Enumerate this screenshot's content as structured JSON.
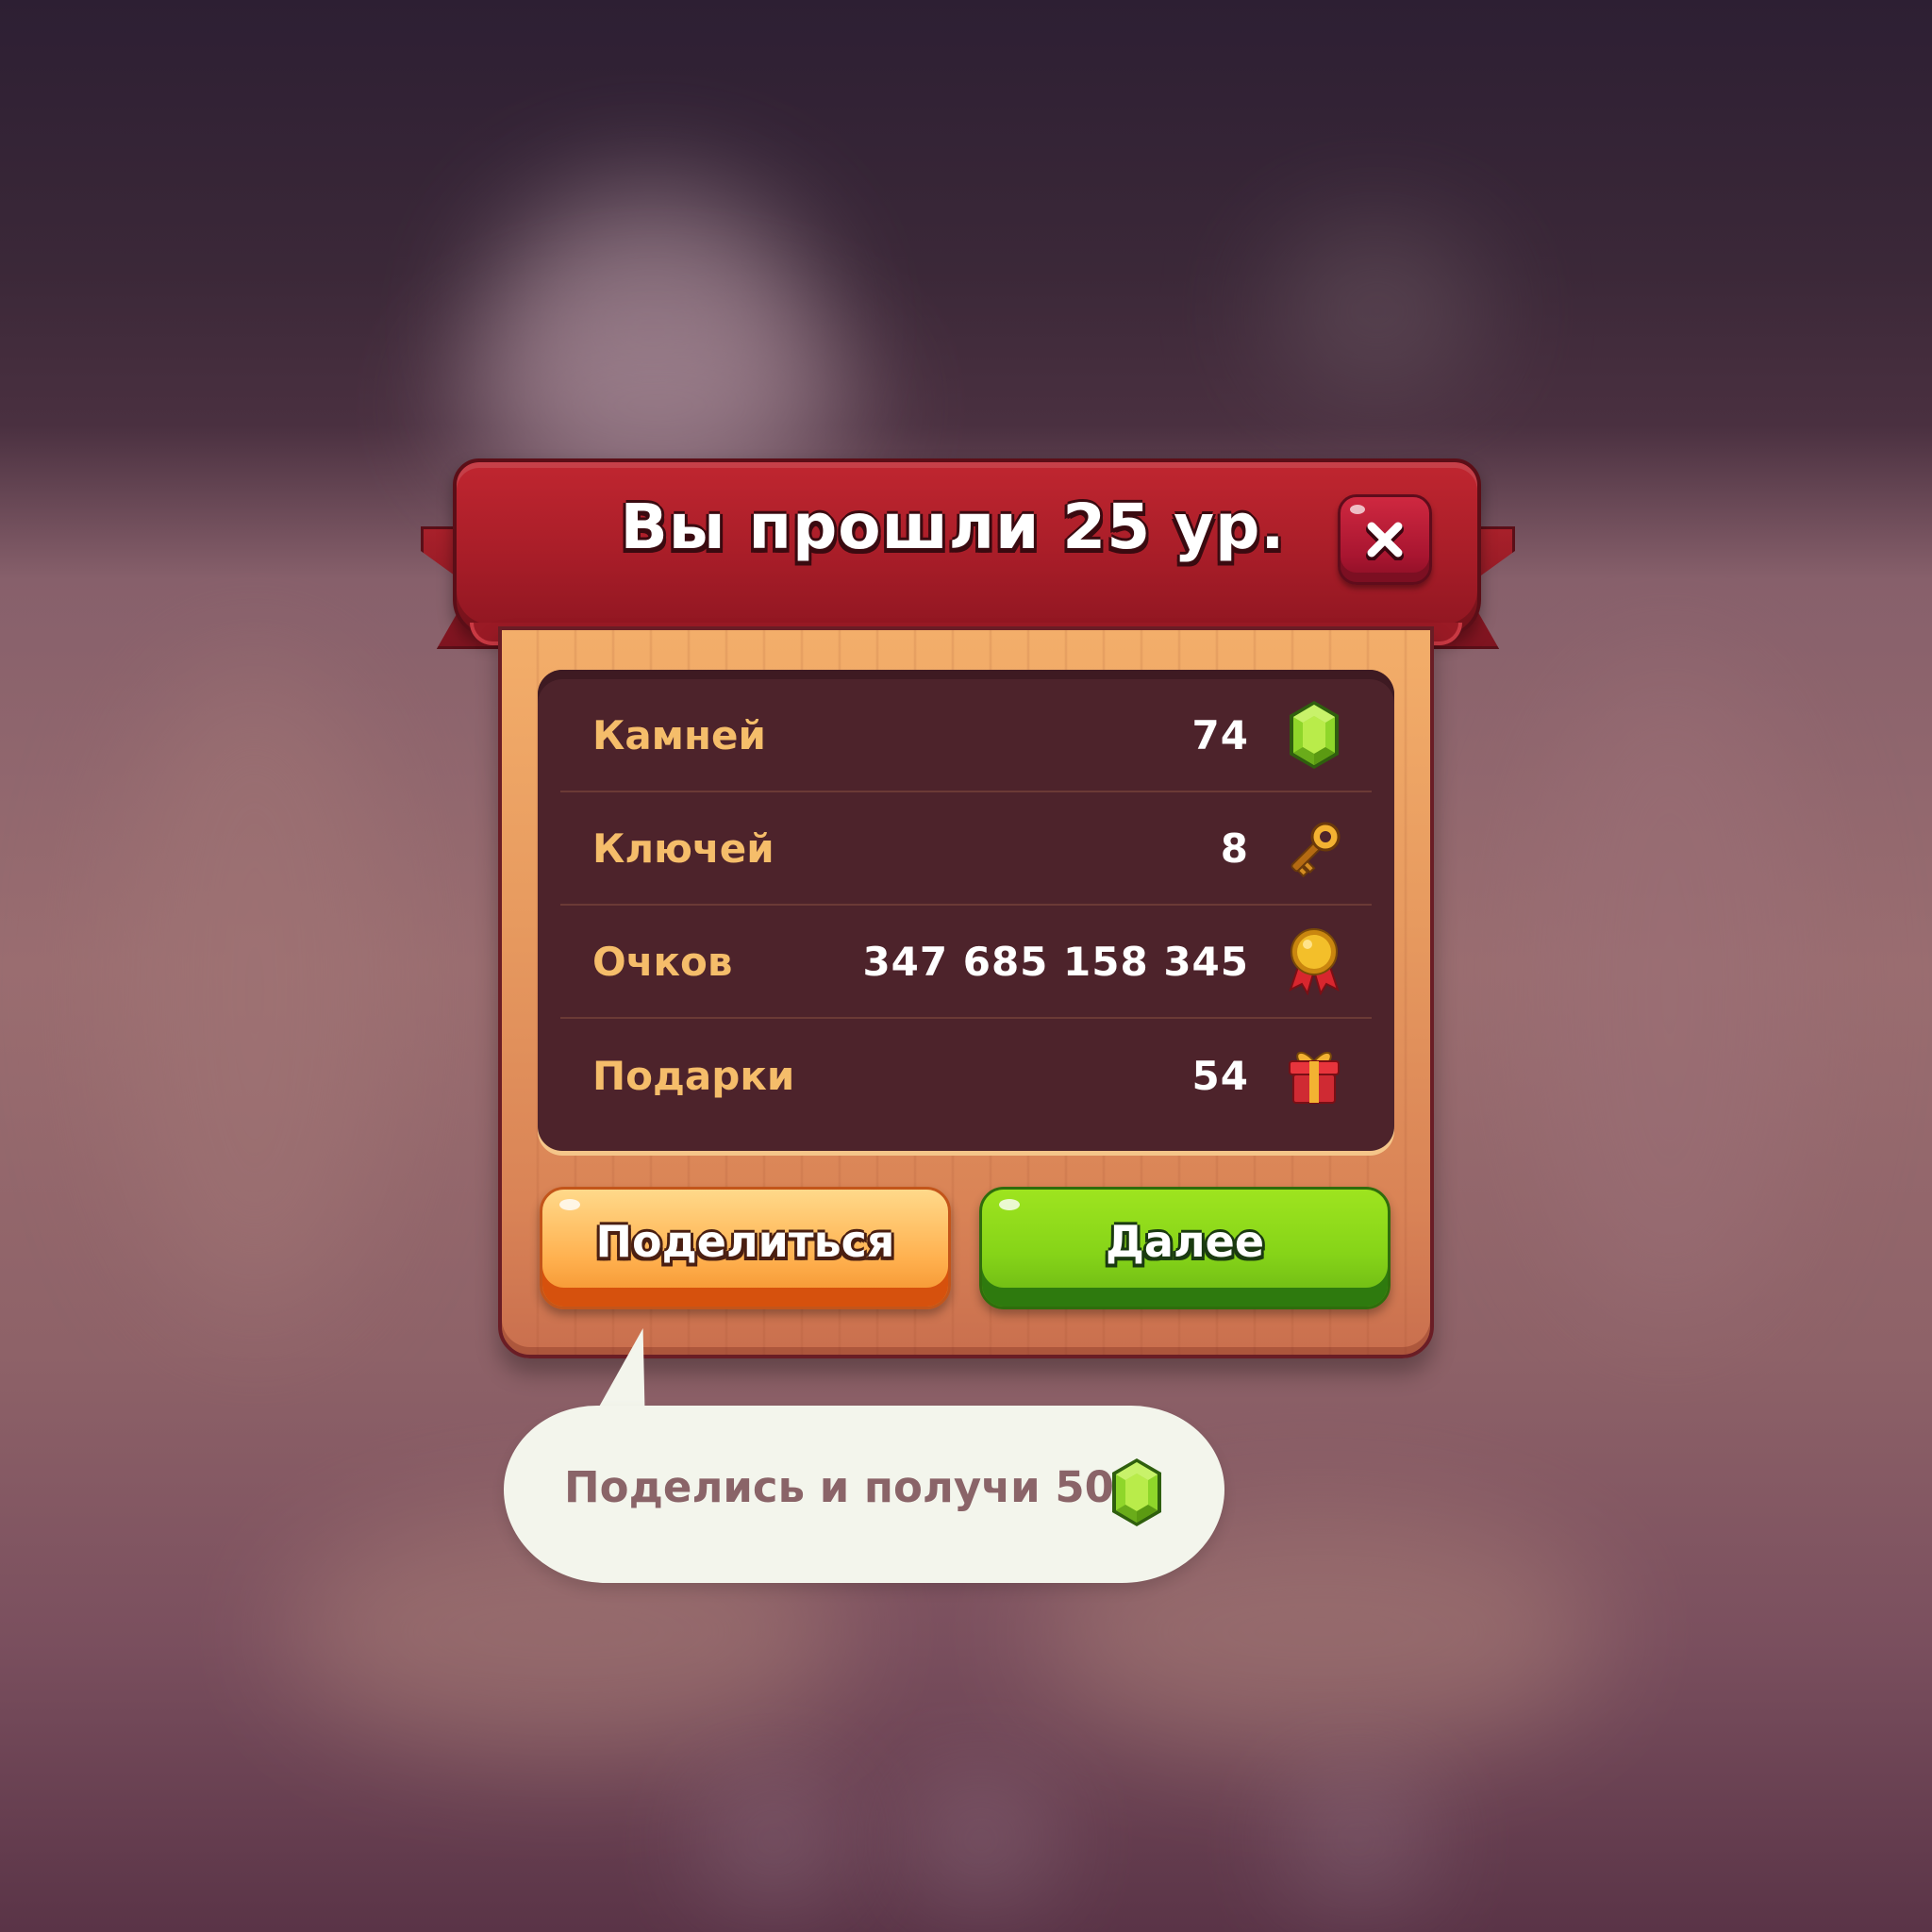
{
  "dialog": {
    "title": "Вы прошли 25 ур.",
    "close_icon": "close-icon"
  },
  "stats": [
    {
      "label": "Камней",
      "value": "74",
      "icon": "gem-icon"
    },
    {
      "label": "Ключей",
      "value": "8",
      "icon": "key-icon"
    },
    {
      "label": "Очков",
      "value": "347 685 158 345",
      "icon": "medal-icon"
    },
    {
      "label": "Подарки",
      "value": "54",
      "icon": "gift-icon"
    }
  ],
  "buttons": {
    "share_label": "Поделиться",
    "next_label": "Далее"
  },
  "tooltip": {
    "text": "Поделись и получи 50",
    "icon": "gem-icon"
  },
  "colors": {
    "ribbon": "#a81d28",
    "label": "#f5bd6a",
    "share_button": "#ffb04e",
    "next_button": "#86d418",
    "gem": "#8fd62a"
  }
}
